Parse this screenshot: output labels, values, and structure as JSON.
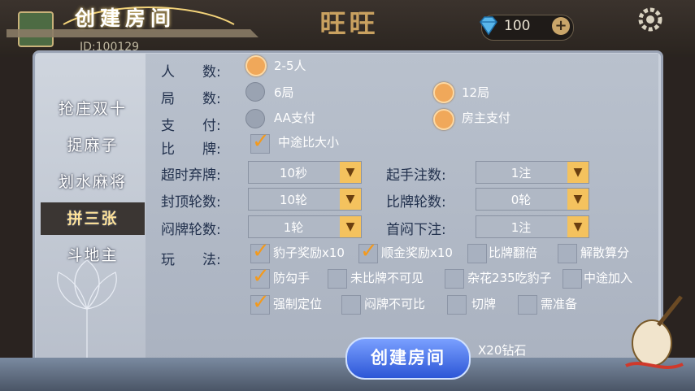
{
  "header": {
    "title": "创建房间",
    "lobby_name": "旺旺",
    "user_id": "ID:100129",
    "diamonds": "100",
    "plus_label": "+"
  },
  "tabs": [
    {
      "label": "抢庄双十",
      "active": false
    },
    {
      "label": "捉麻子",
      "active": false
    },
    {
      "label": "划水麻将",
      "active": false
    },
    {
      "label": "拼三张",
      "active": true
    },
    {
      "label": "斗地主",
      "active": false
    }
  ],
  "form": {
    "players": {
      "label": "人　　数:",
      "option": "2-5人",
      "selected": true
    },
    "rounds": {
      "label": "局　　数:",
      "options": [
        {
          "text": "6局",
          "selected": false
        },
        {
          "text": "12局",
          "selected": true
        }
      ]
    },
    "payment": {
      "label": "支　　付:",
      "options": [
        {
          "text": "AA支付",
          "selected": false
        },
        {
          "text": "房主支付",
          "selected": true
        }
      ]
    },
    "compare": {
      "label": "比　　牌:",
      "option": "中途比大小",
      "checked": true
    },
    "selects": [
      {
        "label": "超时弃牌:",
        "value": "10秒"
      },
      {
        "label": "起手注数:",
        "value": "1注"
      },
      {
        "label": "封顶轮数:",
        "value": "10轮"
      },
      {
        "label": "比牌轮数:",
        "value": "0轮"
      },
      {
        "label": "闷牌轮数:",
        "value": "1轮"
      },
      {
        "label": "首闷下注:",
        "value": "1注"
      }
    ],
    "play_label": "玩　　法:",
    "rules": [
      {
        "text": "豹子奖励x10",
        "checked": true
      },
      {
        "text": "顺金奖励x10",
        "checked": true
      },
      {
        "text": "比牌翻倍",
        "checked": false
      },
      {
        "text": "解散算分",
        "checked": false
      },
      {
        "text": "防勾手",
        "checked": true
      },
      {
        "text": "未比牌不可见",
        "checked": false
      },
      {
        "text": "杂花235吃豹子",
        "checked": false
      },
      {
        "text": "中途加入",
        "checked": false
      },
      {
        "text": "强制定位",
        "checked": true
      },
      {
        "text": "闷牌不可比",
        "checked": false
      },
      {
        "text": "切牌",
        "checked": false
      },
      {
        "text": "需准备",
        "checked": false
      }
    ]
  },
  "footer": {
    "create_label": "创建房间",
    "cost": "X20钻石"
  },
  "colors": {
    "accent": "#f0a85a",
    "button": "#2c56d6",
    "panel": "#c9d0db"
  }
}
